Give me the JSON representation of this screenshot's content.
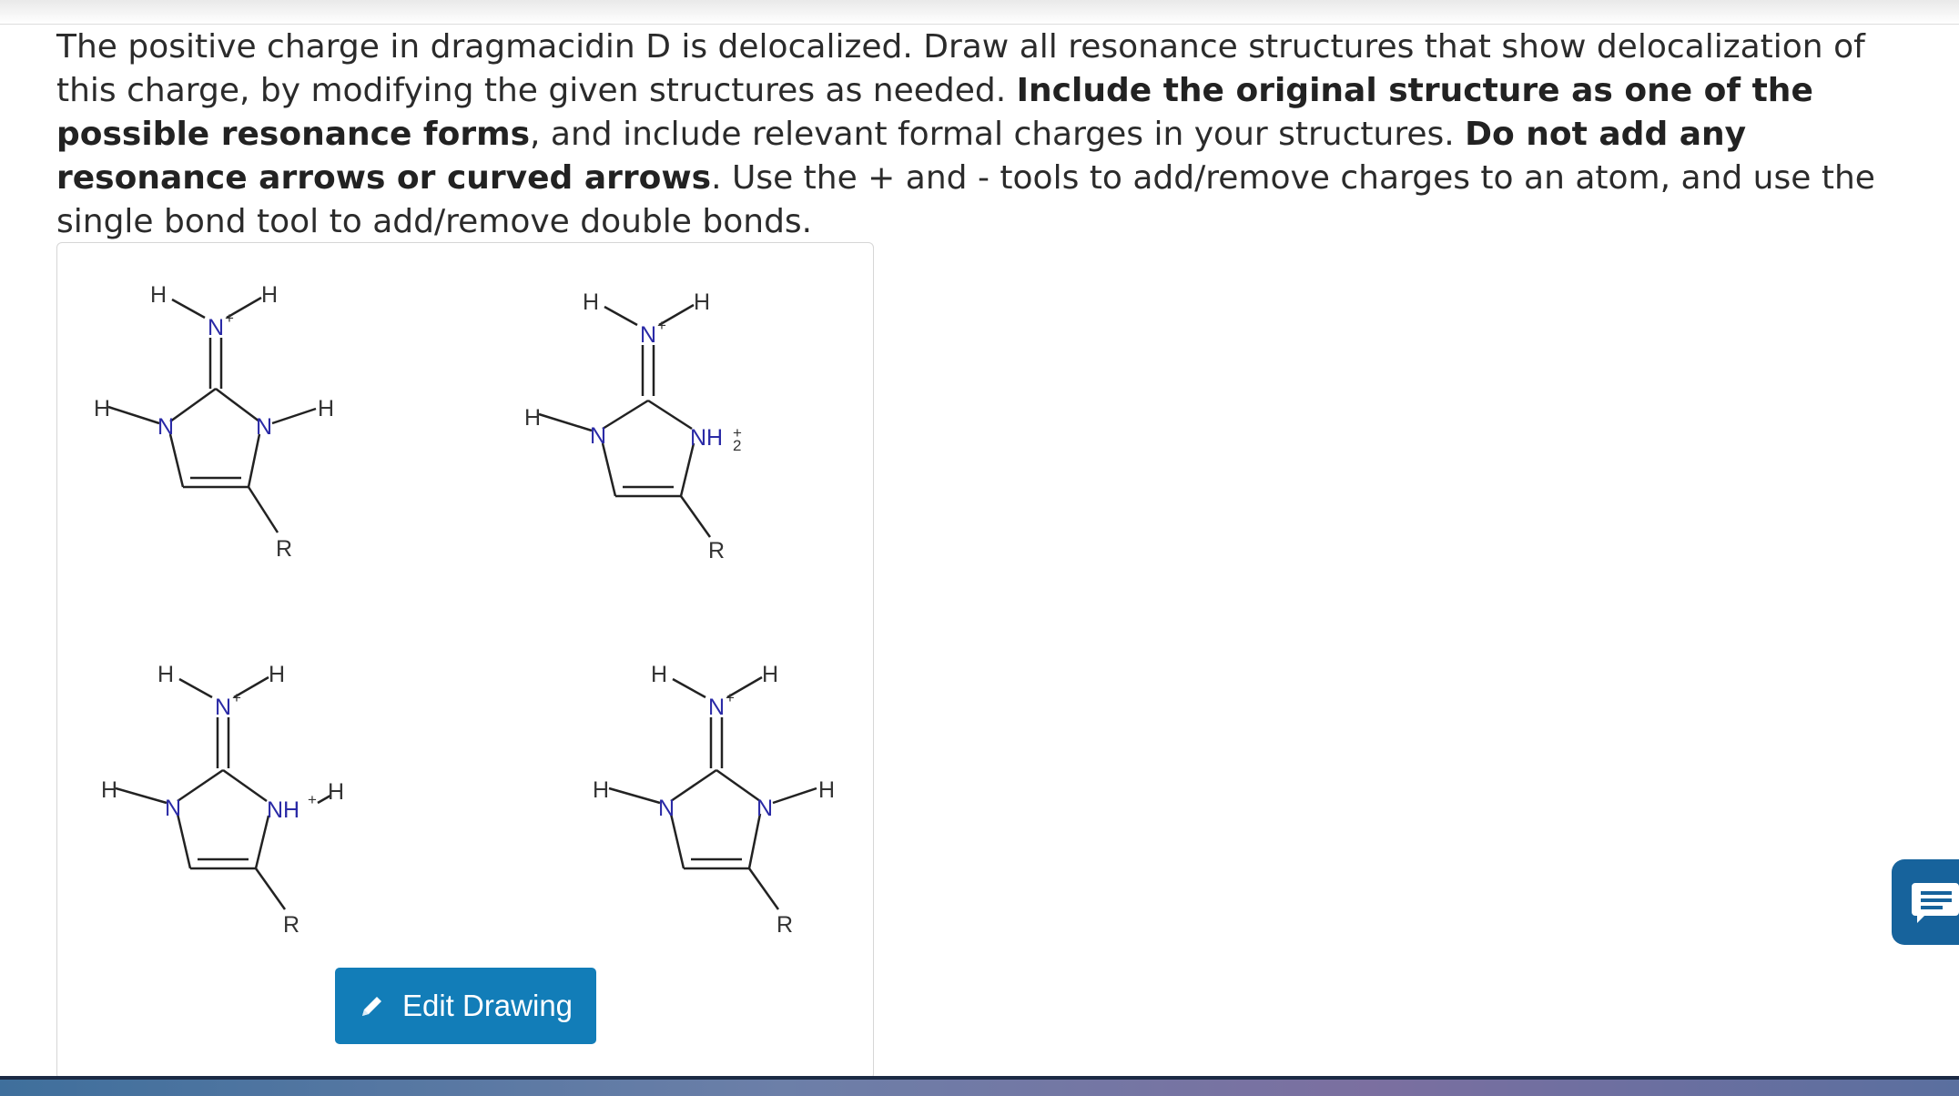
{
  "question": {
    "text_1": "The positive charge in dragmacidin D is delocalized. Draw all resonance structures that show delocalization of this charge, by modifying the given structures as needed. ",
    "bold_1": "Include the original structure as one of the possible resonance forms",
    "text_2": ", and include relevant formal charges in your structures. ",
    "bold_2": "Do not add any resonance arrows or curved arrows",
    "text_3": ". Use the + and - tools to add/remove charges to an atom, and use the single bond tool to add/remove double bonds."
  },
  "atoms": {
    "H": "H",
    "N": "N",
    "R": "R",
    "NH": "NH",
    "plus": "+",
    "sub2": "2"
  },
  "buttons": {
    "edit_drawing": "Edit Drawing"
  },
  "icons": {
    "edit": "pencil-icon",
    "chat": "chat-icon"
  },
  "colors": {
    "button_bg": "#127db8",
    "nitrogen": "#2a2aa6",
    "chat_bg": "#17639c"
  }
}
